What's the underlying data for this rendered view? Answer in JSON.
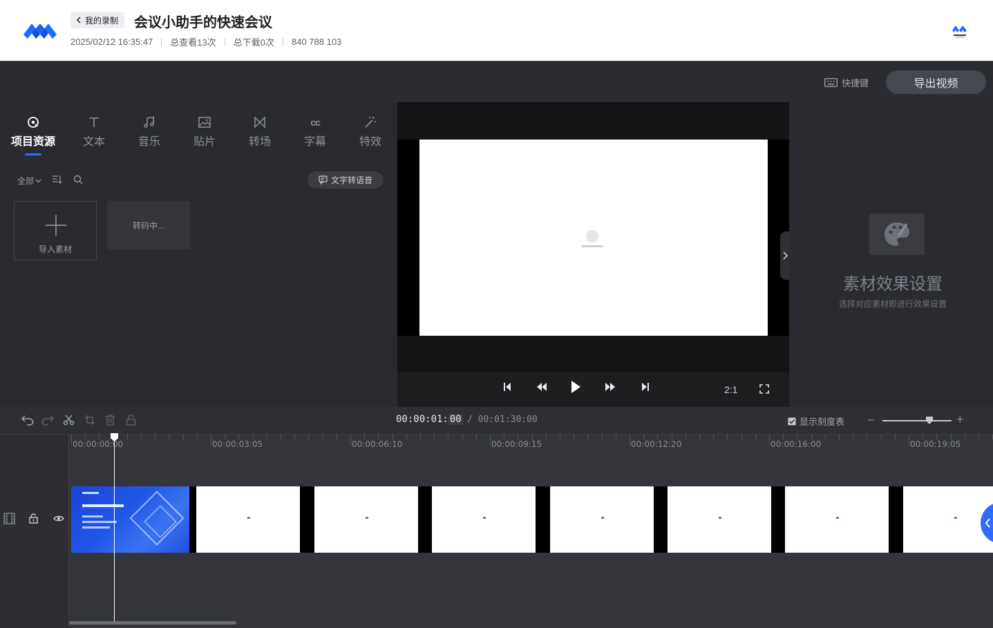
{
  "header": {
    "back_label": "我的录制",
    "title": "会议小助手的快速会议",
    "datetime": "2025/02/12 16:35:47",
    "views": "总查看13次",
    "downloads": "总下载0次",
    "meeting_id": "840 788 103"
  },
  "topbar": {
    "shortcut_label": "快捷键",
    "export_label": "导出视频"
  },
  "tabs": [
    {
      "label": "项目资源",
      "icon": "project-resource-icon",
      "active": true
    },
    {
      "label": "文本",
      "icon": "text-icon"
    },
    {
      "label": "音乐",
      "icon": "music-icon"
    },
    {
      "label": "贴片",
      "icon": "sticker-icon"
    },
    {
      "label": "转场",
      "icon": "transition-icon"
    },
    {
      "label": "字幕",
      "icon": "caption-icon"
    },
    {
      "label": "特效",
      "icon": "effects-wand-icon"
    }
  ],
  "resources": {
    "filter_label": "全部",
    "tts_label": "文字转语音",
    "import_label": "导入素材",
    "transcoding_label": "转码中..."
  },
  "player": {
    "ratio": "2:1"
  },
  "effect_panel": {
    "title": "素材效果设置",
    "subtitle": "选择对应素材即进行效果设置"
  },
  "timeline": {
    "current_time": "00:00:01:",
    "current_frame": "00",
    "total_time": "/ 00:01:30:00",
    "show_scale_label": "显示刻度表",
    "ruler_labels": [
      "00:00:00:00",
      "00:00:03:05",
      "00:00:06:10",
      "00:00:09:15",
      "00:00:12:20",
      "00:00:16:00",
      "00:00:19:05"
    ]
  },
  "colors": {
    "accent": "#2f6bff",
    "panel": "#2a2b30",
    "header_bg": "#ffffff"
  }
}
